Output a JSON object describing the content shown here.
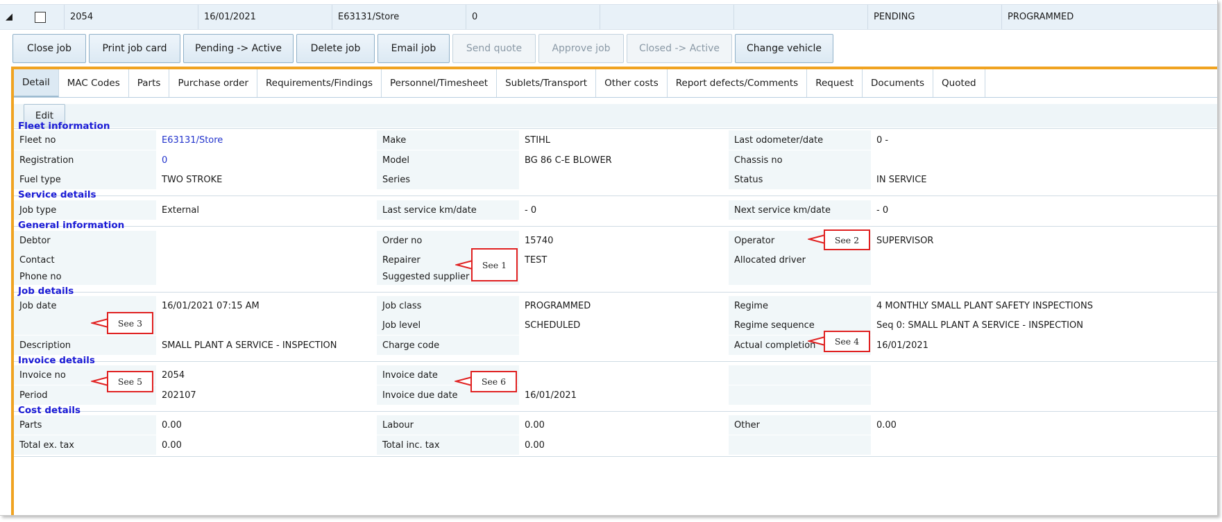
{
  "header_row": {
    "job_no": "2054",
    "date": "16/01/2021",
    "fleet": "E63131/Store",
    "value": "0",
    "status": "PENDING",
    "type": "PROGRAMMED"
  },
  "toolbar": [
    {
      "label": "Close job",
      "enabled": true
    },
    {
      "label": "Print job card",
      "enabled": true
    },
    {
      "label": "Pending -> Active",
      "enabled": true
    },
    {
      "label": "Delete job",
      "enabled": true
    },
    {
      "label": "Email job",
      "enabled": true
    },
    {
      "label": "Send quote",
      "enabled": false
    },
    {
      "label": "Approve job",
      "enabled": false
    },
    {
      "label": "Closed -> Active",
      "enabled": false
    },
    {
      "label": "Change vehicle",
      "enabled": true
    }
  ],
  "tabs": [
    {
      "label": "Detail",
      "active": true
    },
    {
      "label": "MAC Codes"
    },
    {
      "label": "Parts"
    },
    {
      "label": "Purchase order"
    },
    {
      "label": "Requirements/Findings"
    },
    {
      "label": "Personnel/Timesheet"
    },
    {
      "label": "Sublets/Transport"
    },
    {
      "label": "Other costs"
    },
    {
      "label": "Report defects/Comments"
    },
    {
      "label": "Request"
    },
    {
      "label": "Documents"
    },
    {
      "label": "Quoted"
    }
  ],
  "edit_label": "Edit",
  "sections": {
    "fleet": {
      "title": "Fleet information",
      "rows": [
        [
          "Fleet no",
          "E63131/Store",
          "Make",
          "STIHL",
          "Last odometer/date",
          "0 -"
        ],
        [
          "Registration",
          "0",
          "Model",
          "BG 86 C-E BLOWER",
          "Chassis no",
          ""
        ],
        [
          "Fuel type",
          "TWO STROKE",
          "Series",
          "",
          "Status",
          "IN SERVICE"
        ]
      ]
    },
    "service": {
      "title": "Service details",
      "rows": [
        [
          "Job type",
          "External",
          "Last service km/date",
          "- 0",
          "Next service km/date",
          "- 0"
        ]
      ]
    },
    "general": {
      "title": "General information",
      "rows": [
        [
          "Debtor",
          "",
          "Order no",
          "15740",
          "Operator",
          "SUPERVISOR"
        ],
        [
          "Contact",
          "",
          "Repairer",
          "TEST",
          "Allocated driver",
          ""
        ],
        [
          "Phone no",
          "",
          "Suggested supplier",
          "",
          "",
          ""
        ]
      ]
    },
    "job": {
      "title": "Job details",
      "rows": [
        [
          "Job date",
          "16/01/2021 07:15 AM",
          "Job class",
          "PROGRAMMED",
          "Regime",
          "4 MONTHLY SMALL PLANT SAFETY INSPECTIONS"
        ],
        [
          "",
          "",
          "Job level",
          "SCHEDULED",
          "Regime sequence",
          "Seq 0: SMALL PLANT A SERVICE - INSPECTION"
        ],
        [
          "Description",
          "SMALL PLANT A SERVICE - INSPECTION",
          "Charge code",
          "",
          "Actual completion",
          "16/01/2021"
        ]
      ]
    },
    "invoice": {
      "title": "Invoice details",
      "rows": [
        [
          "Invoice no",
          "2054",
          "Invoice date",
          "",
          "",
          ""
        ],
        [
          "Period",
          "202107",
          "Invoice due date",
          "16/01/2021",
          "",
          ""
        ]
      ]
    },
    "cost": {
      "title": "Cost details",
      "rows": [
        [
          "Parts",
          "0.00",
          "Labour",
          "0.00",
          "Other",
          "0.00"
        ],
        [
          "Total ex. tax",
          "0.00",
          "Total inc. tax",
          "0.00",
          "",
          ""
        ]
      ]
    }
  },
  "callouts": [
    "See 1",
    "See 2",
    "See 3",
    "See 4",
    "See 5",
    "See 6"
  ],
  "colors": {
    "accent_border": "#f0a321",
    "section_title": "#1b1bd6",
    "callout_border": "#e02020",
    "link": "#2233cc"
  }
}
